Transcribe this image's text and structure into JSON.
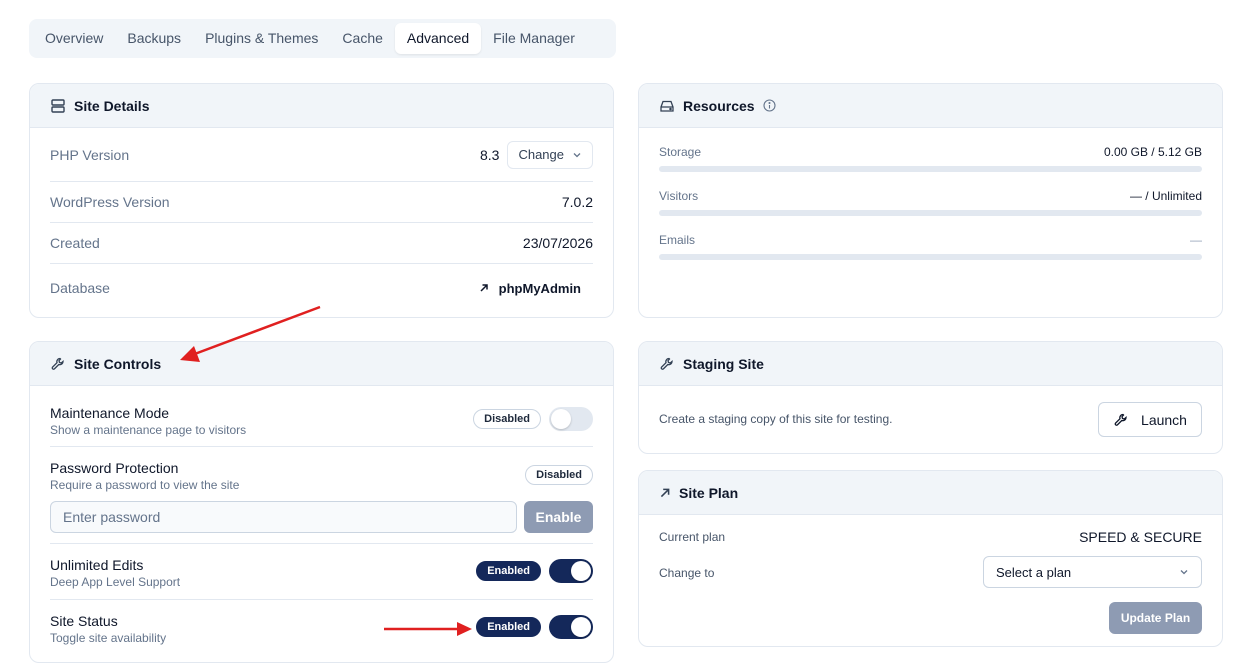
{
  "tabs": [
    {
      "label": "Overview",
      "active": false
    },
    {
      "label": "Backups",
      "active": false
    },
    {
      "label": "Plugins & Themes",
      "active": false
    },
    {
      "label": "Cache",
      "active": false
    },
    {
      "label": "Advanced",
      "active": true
    },
    {
      "label": "File Manager",
      "active": false
    }
  ],
  "site_details": {
    "title": "Site Details",
    "php_label": "PHP Version",
    "php_value": "8.3",
    "change_label": "Change",
    "wp_label": "WordPress Version",
    "wp_value": "7.0.2",
    "created_label": "Created",
    "created_value": "23/07/2026",
    "db_label": "Database",
    "db_link": "phpMyAdmin"
  },
  "site_controls": {
    "title": "Site Controls",
    "maintenance": {
      "title": "Maintenance Mode",
      "subtitle": "Show a maintenance page to visitors",
      "status": "Disabled",
      "enabled": false
    },
    "password": {
      "title": "Password Protection",
      "subtitle": "Require a password to view the site",
      "status": "Disabled",
      "placeholder": "Enter password",
      "button": "Enable"
    },
    "unlimited": {
      "title": "Unlimited Edits",
      "subtitle": "Deep App Level Support",
      "status": "Enabled",
      "enabled": true
    },
    "site_status": {
      "title": "Site Status",
      "subtitle": "Toggle site availability",
      "status": "Enabled",
      "enabled": true
    }
  },
  "resources": {
    "title": "Resources",
    "storage": {
      "label": "Storage",
      "value": "0.00 GB / 5.12 GB",
      "fraction": 0
    },
    "visitors": {
      "label": "Visitors",
      "value": "— / Unlimited",
      "fraction": 0
    },
    "emails": {
      "label": "Emails",
      "value": "—",
      "fraction": 0
    }
  },
  "staging": {
    "title": "Staging Site",
    "description": "Create a staging copy of this site for testing.",
    "button": "Launch"
  },
  "site_plan": {
    "title": "Site Plan",
    "current_label": "Current plan",
    "current_value": "SPEED & SECURE",
    "change_label": "Change to",
    "select_value": "Select a plan",
    "button": "Update Plan"
  },
  "colors": {
    "accent": "#14285a",
    "annotation": "#e02020",
    "muted_button": "#8e9bb3"
  }
}
